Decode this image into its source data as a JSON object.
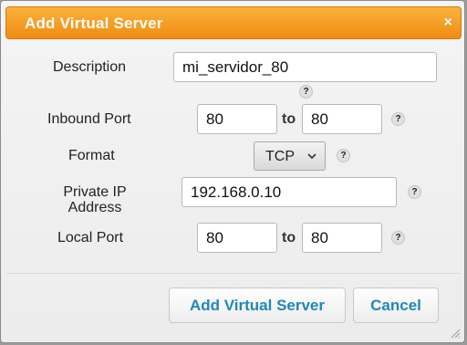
{
  "dialog": {
    "title": "Add Virtual Server",
    "close_glyph": "×"
  },
  "form": {
    "description": {
      "label": "Description",
      "value": "mi_servidor_80",
      "help": "?"
    },
    "inbound_port": {
      "label": "Inbound Port",
      "from": "80",
      "to_label": "to",
      "to": "80",
      "help": "?"
    },
    "format": {
      "label": "Format",
      "selected": "TCP",
      "help": "?"
    },
    "private_ip": {
      "label_line1": "Private IP",
      "label_line2": "Address",
      "value": "192.168.0.10",
      "help": "?"
    },
    "local_port": {
      "label": "Local Port",
      "from": "80",
      "to_label": "to",
      "to": "80",
      "help": "?"
    }
  },
  "buttons": {
    "submit_label": "Add Virtual Server",
    "cancel_label": "Cancel"
  },
  "colors": {
    "title_bar": "#f5a025",
    "button_text": "#1e88b8"
  },
  "icons": [
    "close-icon",
    "help-icon",
    "chevron-down-icon",
    "resize-grip-icon"
  ]
}
